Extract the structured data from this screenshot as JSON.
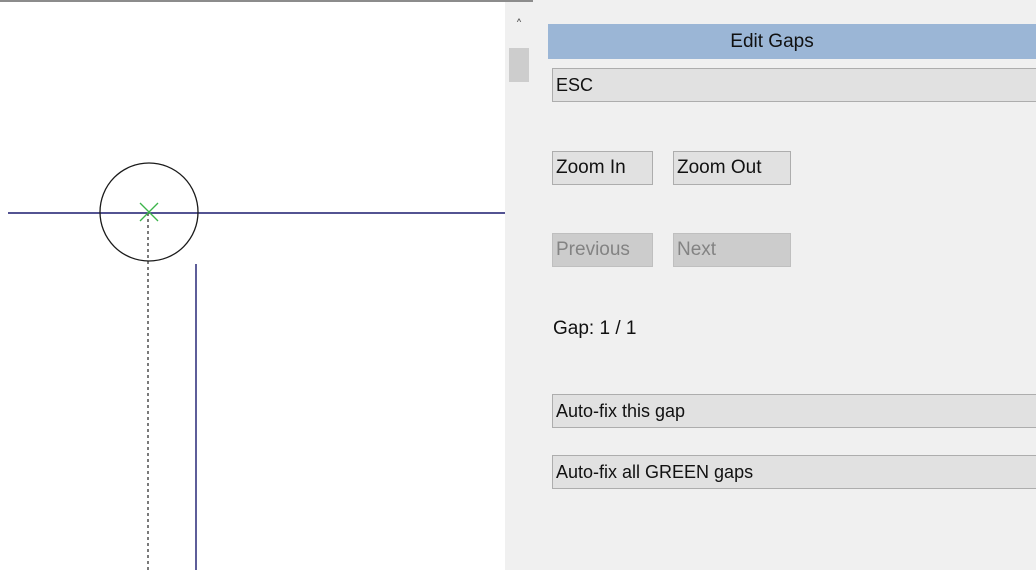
{
  "panel": {
    "title": "Edit Gaps",
    "esc_label": "ESC",
    "zoom_in_label": "Zoom In",
    "zoom_out_label": "Zoom Out",
    "previous_label": "Previous",
    "next_label": "Next",
    "gap_label": "Gap:  1 / 1",
    "autofix_this_label": "Auto-fix this gap",
    "autofix_all_label": "Auto-fix all GREEN gaps"
  },
  "scrollbar": {
    "up_icon": "chevron-up-icon"
  },
  "colors": {
    "header": "#9bb6d6",
    "line": "#1a1a6e",
    "gap_marker": "#3cb44b",
    "panel_bg": "#f0f0f0"
  }
}
